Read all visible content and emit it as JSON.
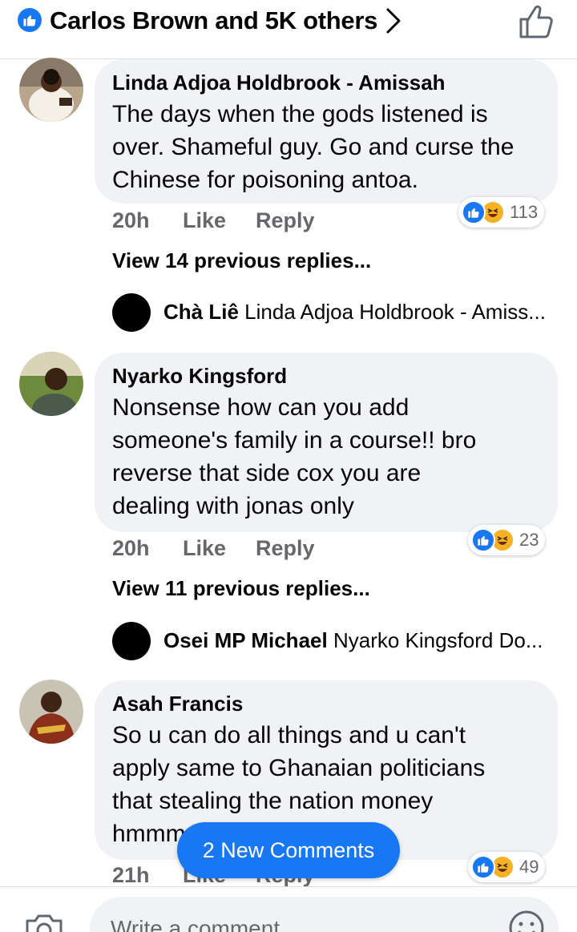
{
  "header": {
    "title": "Carlos Brown and 5K others"
  },
  "comments": [
    {
      "author": "Linda Adjoa Holdbrook - Amissah",
      "lines": [
        "The days when the gods listened is",
        "over. Shameful guy. Go and curse the",
        "Chinese for poisoning antoa."
      ],
      "time": "20h",
      "like_label": "Like",
      "reply_label": "Reply",
      "reaction_count": "113",
      "view_replies": "View 14 previous replies...",
      "latest_reply": {
        "name": "Chà Liê",
        "snippet": "Linda Adjoa Holdbrook - Amiss..."
      }
    },
    {
      "author": "Nyarko Kingsford",
      "lines": [
        "Nonsense  how can  you  add",
        "someone's family in a course!! bro",
        "reverse that side cox you  are",
        "dealing with  jonas only"
      ],
      "time": "20h",
      "like_label": "Like",
      "reply_label": "Reply",
      "reaction_count": "23",
      "view_replies": "View 11 previous replies...",
      "latest_reply": {
        "name": "Osei MP Michael",
        "snippet": "Nyarko Kingsford Do..."
      }
    },
    {
      "author": "Asah Francis",
      "lines": [
        "So u can do all things and u can't",
        "apply same to Ghanaian politicians",
        "that stealing the nation money",
        "hmmm"
      ],
      "time": "21h",
      "like_label": "Like",
      "reply_label": "Reply",
      "reaction_count": "49"
    }
  ],
  "new_comments_pill": "2 New Comments",
  "composer": {
    "placeholder": "Write a comment..."
  },
  "colors": {
    "brand_blue": "#1877f2",
    "bubble_gray": "#f0f2f5",
    "meta_gray": "#65676b",
    "haha_yellow": "#f7b125"
  },
  "icons": [
    "like-badge-icon",
    "chevron-right-icon",
    "thumbs-up-outline-icon",
    "camera-icon",
    "emoji-icon",
    "haha-reaction-icon"
  ]
}
